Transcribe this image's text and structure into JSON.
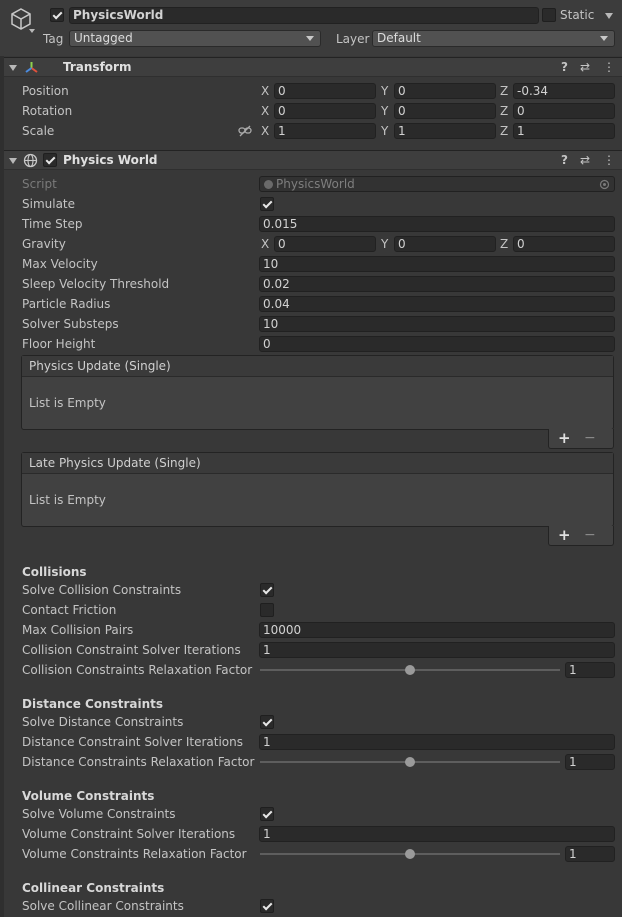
{
  "object": {
    "name": "PhysicsWorld",
    "active": true,
    "static_label": "Static",
    "static": false,
    "tag_label": "Tag",
    "tag_value": "Untagged",
    "layer_label": "Layer",
    "layer_value": "Default"
  },
  "transform": {
    "title": "Transform",
    "position": {
      "label": "Position",
      "x": "0",
      "y": "0",
      "z": "-0.34"
    },
    "rotation": {
      "label": "Rotation",
      "x": "0",
      "y": "0",
      "z": "0"
    },
    "scale": {
      "label": "Scale",
      "x": "1",
      "y": "1",
      "z": "1"
    }
  },
  "axes": {
    "x": "X",
    "y": "Y",
    "z": "Z"
  },
  "physics": {
    "title": "Physics World",
    "enabled": true,
    "script_label": "Script",
    "script_value": "PhysicsWorld",
    "simulate_label": "Simulate",
    "simulate": true,
    "time_step_label": "Time Step",
    "time_step": "0.015",
    "gravity_label": "Gravity",
    "gravity": {
      "x": "0",
      "y": "0",
      "z": "0"
    },
    "max_velocity_label": "Max Velocity",
    "max_velocity": "10",
    "sleep_label": "Sleep Velocity Threshold",
    "sleep": "0.02",
    "radius_label": "Particle Radius",
    "radius": "0.04",
    "substeps_label": "Solver Substeps",
    "substeps": "10",
    "floor_label": "Floor Height",
    "floor": "0",
    "physics_update": {
      "title": "Physics Update (Single)",
      "empty": "List is Empty"
    },
    "late_update": {
      "title": "Late Physics Update (Single)",
      "empty": "List is Empty"
    },
    "add": "+",
    "remove": "−"
  },
  "collisions": {
    "title": "Collisions",
    "solve_label": "Solve Collision Constraints",
    "solve": true,
    "friction_label": "Contact Friction",
    "friction": false,
    "pairs_label": "Max Collision Pairs",
    "pairs": "10000",
    "iter_label": "Collision Constraint Solver Iterations",
    "iter": "1",
    "relax_label": "Collision Constraints Relaxation Factor",
    "relax": "1",
    "relax_slider_fraction": 0.5
  },
  "distance": {
    "title": "Distance Constraints",
    "solve_label": "Solve Distance Constraints",
    "solve": true,
    "iter_label": "Distance Constraint Solver Iterations",
    "iter": "1",
    "relax_label": "Distance Constraints Relaxation Factor",
    "relax": "1",
    "relax_slider_fraction": 0.5
  },
  "volume": {
    "title": "Volume Constraints",
    "solve_label": "Solve Volume Constraints",
    "solve": true,
    "iter_label": "Volume Constraint Solver Iterations",
    "iter": "1",
    "relax_label": "Volume Constraints Relaxation Factor",
    "relax": "1",
    "relax_slider_fraction": 0.5
  },
  "collinear": {
    "title": "Collinear Constraints",
    "solve_label": "Solve Collinear Constraints",
    "solve": true
  },
  "icons": {
    "help": "?",
    "presets": "⇄",
    "menu": "⋮"
  }
}
